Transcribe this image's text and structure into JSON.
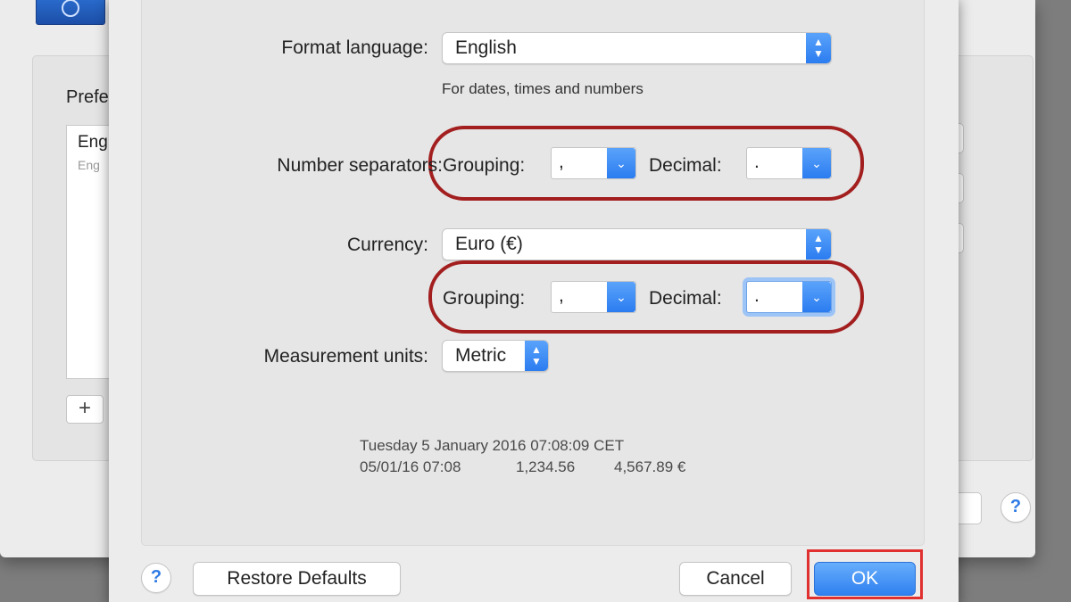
{
  "background": {
    "pref_label": "Prefe",
    "list_item_primary": "Eng",
    "list_item_secondary": "Eng",
    "add_label": "+",
    "help_label": "?"
  },
  "format_language": {
    "label": "Format language:",
    "value": "English",
    "hint": "For dates, times and numbers"
  },
  "number_separators": {
    "label": "Number separators:",
    "grouping_label": "Grouping:",
    "grouping_value": ",",
    "decimal_label": "Decimal:",
    "decimal_value": "."
  },
  "currency": {
    "label": "Currency:",
    "value": "Euro (€)",
    "grouping_label": "Grouping:",
    "grouping_value": ",",
    "decimal_label": "Decimal:",
    "decimal_value": "."
  },
  "measurement": {
    "label": "Measurement units:",
    "value": "Metric"
  },
  "preview": {
    "line1": "Tuesday 5 January 2016 07:08:09 CET",
    "date_short": "05/01/16 07:08",
    "number_sample": "1,234.56",
    "currency_sample": "4,567.89 €"
  },
  "buttons": {
    "help": "?",
    "restore_defaults": "Restore Defaults",
    "cancel": "Cancel",
    "ok": "OK"
  },
  "colors": {
    "accent": "#2f80f0",
    "annotation_ellipse": "#a31f1f",
    "annotation_box": "#e03030"
  }
}
